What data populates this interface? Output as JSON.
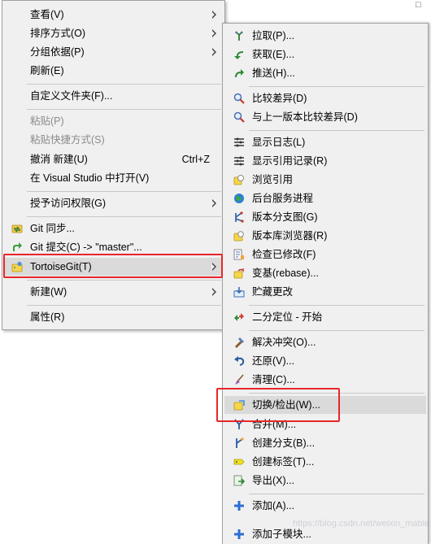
{
  "main_menu": {
    "items": [
      {
        "label": "查看(V)",
        "submenu": true
      },
      {
        "label": "排序方式(O)",
        "submenu": true
      },
      {
        "label": "分组依据(P)",
        "submenu": true
      },
      {
        "label": "刷新(E)"
      },
      {
        "label": "自定义文件夹(F)..."
      },
      {
        "label": "粘贴(P)",
        "disabled": true
      },
      {
        "label": "粘贴快捷方式(S)",
        "disabled": true
      },
      {
        "label": "撤消 新建(U)",
        "shortcut": "Ctrl+Z"
      },
      {
        "label": "在 Visual Studio 中打开(V)"
      },
      {
        "label": "授予访问权限(G)",
        "submenu": true
      },
      {
        "label": "Git 同步...",
        "icon": "git-sync-icon"
      },
      {
        "label": "Git 提交(C) -> \"master\"...",
        "icon": "git-commit-icon"
      },
      {
        "label": "TortoiseGit(T)",
        "icon": "tortoisegit-icon",
        "submenu": true
      },
      {
        "label": "新建(W)",
        "submenu": true
      },
      {
        "label": "属性(R)"
      }
    ]
  },
  "sub_menu": {
    "items": [
      {
        "label": "拉取(P)...",
        "icon": "pull-icon"
      },
      {
        "label": "获取(E)...",
        "icon": "fetch-icon"
      },
      {
        "label": "推送(H)...",
        "icon": "push-icon"
      },
      {
        "label": "比较差异(D)",
        "icon": "diff-magnifier-icon"
      },
      {
        "label": "与上一版本比较差异(D)",
        "icon": "diff-prev-magnifier-icon"
      },
      {
        "label": "显示日志(L)",
        "icon": "log-icon"
      },
      {
        "label": "显示引用记录(R)",
        "icon": "reflog-icon"
      },
      {
        "label": "浏览引用",
        "icon": "browse-refs-icon"
      },
      {
        "label": "后台服务进程",
        "icon": "daemon-globe-icon"
      },
      {
        "label": "版本分支图(G)",
        "icon": "revision-graph-icon"
      },
      {
        "label": "版本库浏览器(R)",
        "icon": "repo-browser-icon"
      },
      {
        "label": "检查已修改(F)",
        "icon": "check-modifications-icon"
      },
      {
        "label": "变基(rebase)...",
        "icon": "rebase-icon"
      },
      {
        "label": "贮藏更改",
        "icon": "stash-icon"
      },
      {
        "label": "二分定位 - 开始",
        "icon": "bisect-icon"
      },
      {
        "label": "解决冲突(O)...",
        "icon": "resolve-icon"
      },
      {
        "label": "还原(V)...",
        "icon": "revert-icon"
      },
      {
        "label": "清理(C)...",
        "icon": "cleanup-icon"
      },
      {
        "label": "切换/检出(W)...",
        "icon": "switch-checkout-icon"
      },
      {
        "label": "合并(M)...",
        "icon": "merge-icon"
      },
      {
        "label": "创建分支(B)...",
        "icon": "create-branch-icon"
      },
      {
        "label": "创建标签(T)...",
        "icon": "create-tag-icon"
      },
      {
        "label": "导出(X)...",
        "icon": "export-icon"
      },
      {
        "label": "添加(A)...",
        "icon": "add-plus-icon"
      },
      {
        "label": "添加子模块...",
        "icon": "add-submodule-icon"
      }
    ]
  },
  "colors": {
    "menu_bg": "#f0f0f0",
    "highlight": "#dadada",
    "callout": "#e8262b",
    "disabled_text": "#8a8a8a"
  },
  "watermark": "https://blog.csdn.net/weixin_mable"
}
